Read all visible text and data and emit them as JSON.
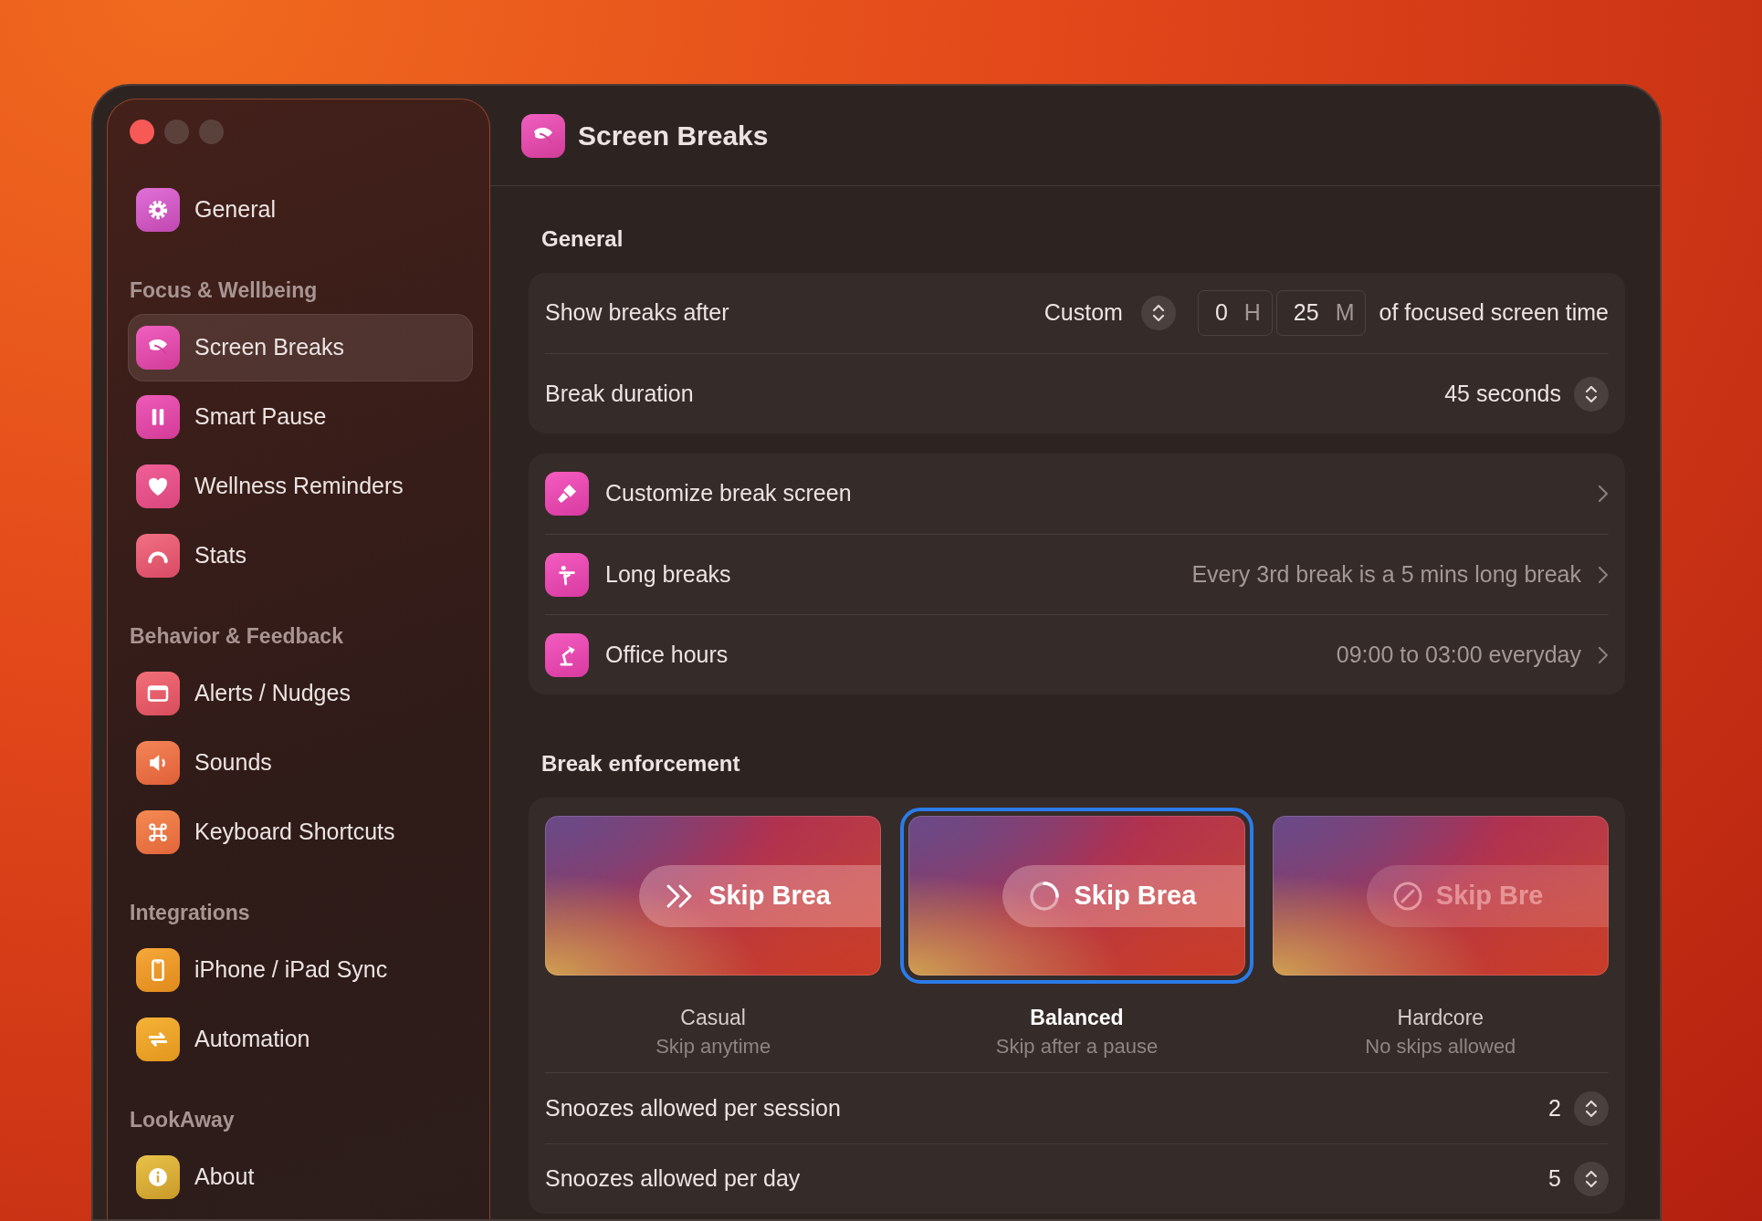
{
  "window": {
    "title": "Screen Breaks"
  },
  "sidebar": {
    "groups": [
      {
        "items": [
          {
            "label": "General",
            "selected": false
          }
        ]
      },
      {
        "heading": "Focus & Wellbeing",
        "items": [
          {
            "label": "Screen Breaks",
            "selected": true
          },
          {
            "label": "Smart Pause",
            "selected": false
          },
          {
            "label": "Wellness Reminders",
            "selected": false
          },
          {
            "label": "Stats",
            "selected": false
          }
        ]
      },
      {
        "heading": "Behavior & Feedback",
        "items": [
          {
            "label": "Alerts / Nudges",
            "selected": false
          },
          {
            "label": "Sounds",
            "selected": false
          },
          {
            "label": "Keyboard Shortcuts",
            "selected": false
          }
        ]
      },
      {
        "heading": "Integrations",
        "items": [
          {
            "label": "iPhone / iPad Sync",
            "selected": false
          },
          {
            "label": "Automation",
            "selected": false
          }
        ]
      },
      {
        "heading": "LookAway",
        "items": [
          {
            "label": "About",
            "selected": false
          }
        ]
      }
    ]
  },
  "general": {
    "heading": "General",
    "rows": [
      {
        "kind": "interval",
        "label": "Show breaks after",
        "mode": "Custom",
        "hours": "0",
        "hours_unit": "H",
        "minutes": "25",
        "minutes_unit": "M",
        "suffix": "of focused screen time"
      },
      {
        "kind": "stepper",
        "label": "Break duration",
        "value": "45 seconds"
      }
    ]
  },
  "links": [
    {
      "label": "Customize break screen"
    },
    {
      "label": "Long breaks",
      "value": "Every 3rd break is a 5 mins long break"
    },
    {
      "label": "Office hours",
      "value": "09:00 to 03:00 everyday"
    }
  ],
  "enforcement": {
    "heading": "Break enforcement",
    "modes": [
      {
        "title": "Casual",
        "subtitle": "Skip anytime",
        "button": "Skip Brea",
        "selected": false
      },
      {
        "title": "Balanced",
        "subtitle": "Skip after a pause",
        "button": "Skip Brea",
        "selected": true
      },
      {
        "title": "Hardcore",
        "subtitle": "No skips allowed",
        "button": "Skip Bre",
        "selected": false
      }
    ],
    "rows": [
      {
        "label": "Snoozes allowed per session",
        "value": "2"
      },
      {
        "label": "Snoozes allowed per day",
        "value": "5"
      }
    ]
  }
}
